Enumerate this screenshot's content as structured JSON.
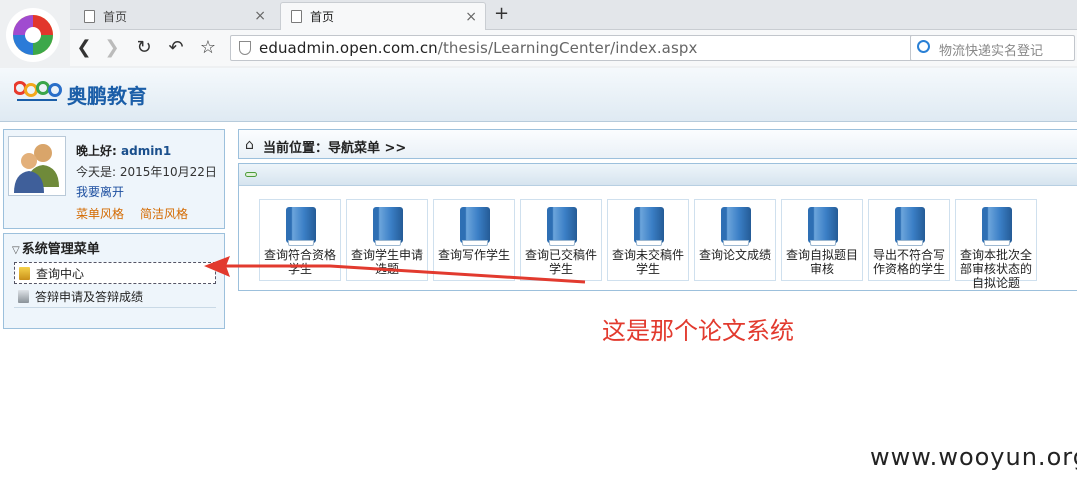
{
  "browser": {
    "tabs": [
      {
        "label": "首页"
      },
      {
        "label": "首页"
      }
    ],
    "url_host": "eduadmin.open.com.cn",
    "url_path": "/thesis/LearningCenter/index.aspx",
    "search_placeholder": "物流快递实名登记",
    "new_tab_label": "+",
    "close_label": "×"
  },
  "app": {
    "logo_mark": "open",
    "logo_text": "奥鹏教育"
  },
  "user_panel": {
    "greeting": "晚上好:",
    "username": "admin1",
    "today": "今天是: 2015年10月22日",
    "leave": "我要离开",
    "style_menu": "菜单风格",
    "style_simple": "简洁风格"
  },
  "menu": {
    "title": "系统管理菜单",
    "items": [
      {
        "label": "查询中心"
      },
      {
        "label": "答辩申请及答辩成绩"
      }
    ]
  },
  "breadcrumb": {
    "text": "当前位置：导航菜单 >>"
  },
  "tiles": [
    {
      "label": "查询符合资格学生"
    },
    {
      "label": "查询学生申请选题"
    },
    {
      "label": "查询写作学生"
    },
    {
      "label": "查询已交稿件学生"
    },
    {
      "label": "查询未交稿件学生"
    },
    {
      "label": "查询论文成绩"
    },
    {
      "label": "查询自拟题目审核"
    },
    {
      "label": "导出不符合写作资格的学生"
    },
    {
      "label": "查询本批次全部审核状态的自拟论题"
    }
  ],
  "annotation": {
    "text": "这是那个论文系统",
    "color": "#e23a2e"
  },
  "watermark": "www.wooyun.org",
  "colors": {
    "accent": "#1b5ea8",
    "panel_border": "#9cc0dc",
    "link_orange": "#d46a00"
  }
}
